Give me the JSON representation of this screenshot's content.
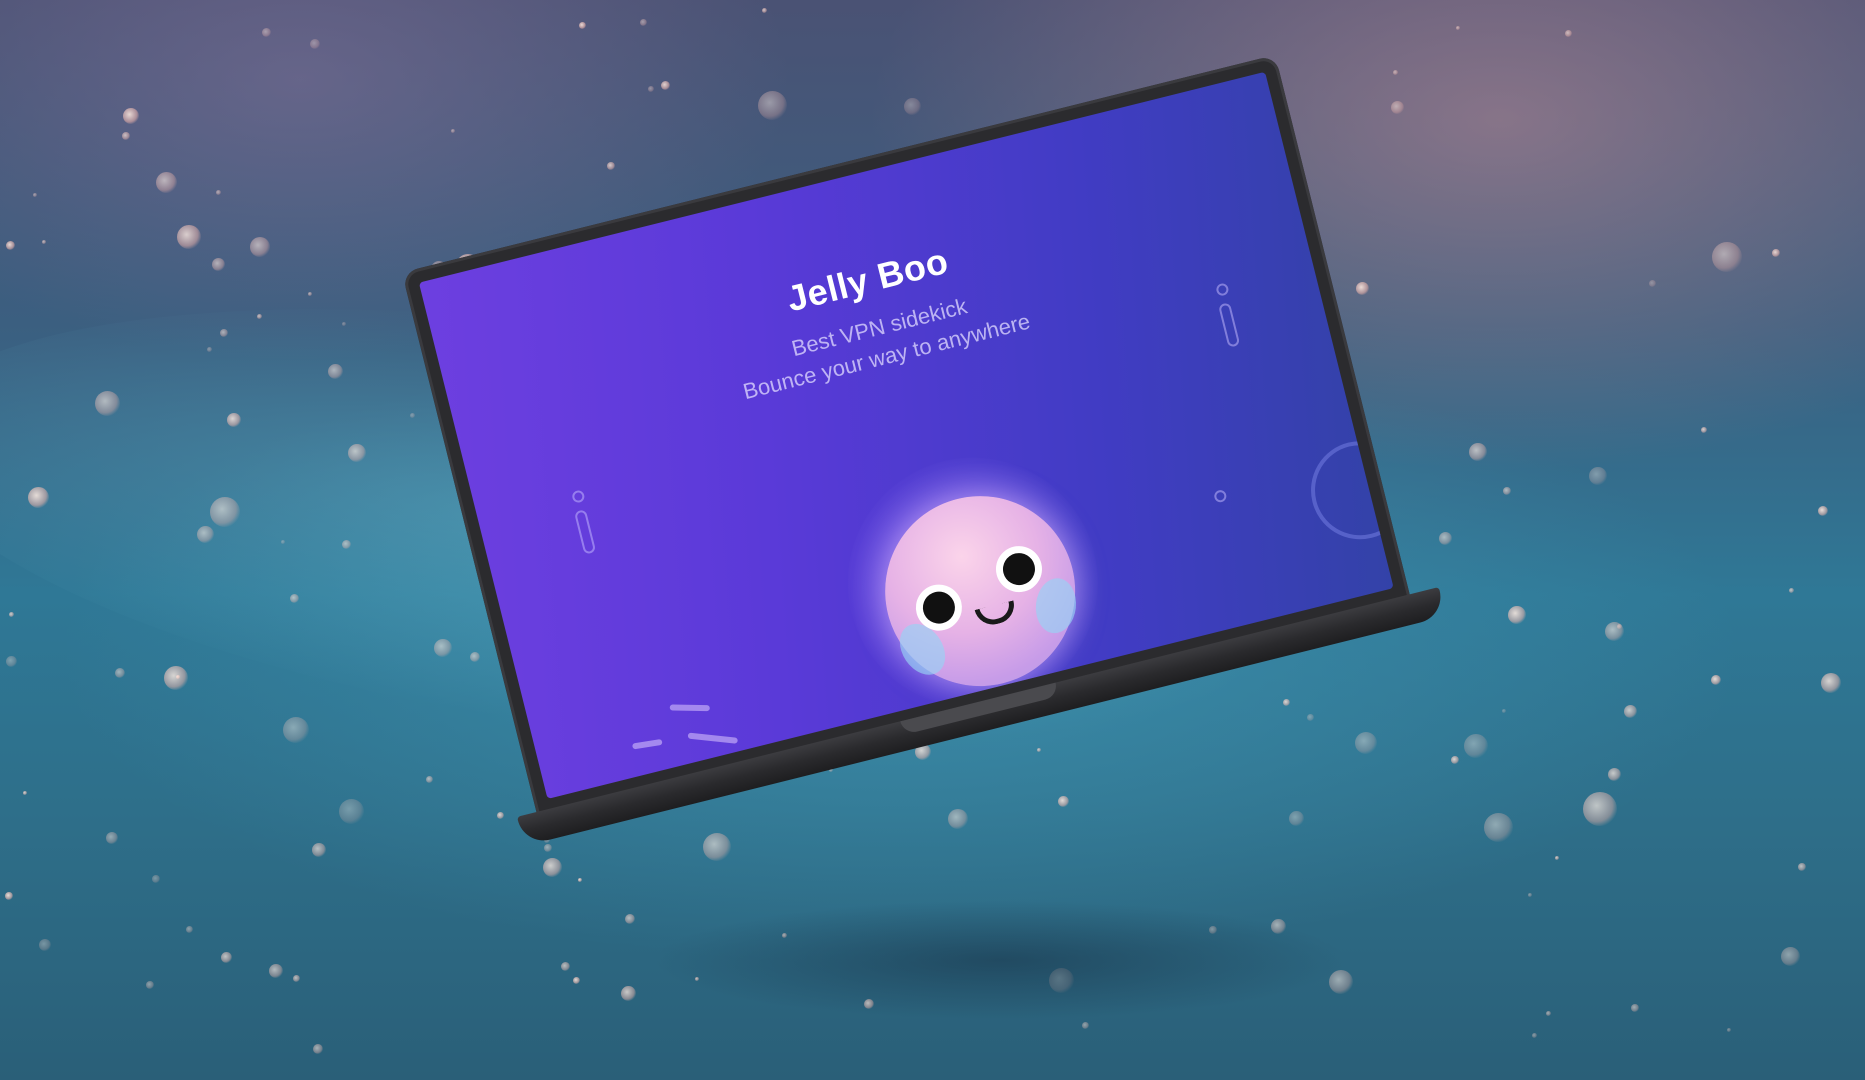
{
  "app": {
    "title": "Jelly Boo",
    "subtitle_line1": "Best VPN sidekick",
    "subtitle_line2": "Bounce your way to anywhere"
  },
  "colors": {
    "screen_gradient_start": "#6d3fe0",
    "screen_gradient_end": "#3342a8",
    "jelly_pink": "#fbd4ea",
    "laptop_body": "#2b2b2e"
  },
  "icons": {
    "mascot": "jellyfish-mascot-icon"
  }
}
